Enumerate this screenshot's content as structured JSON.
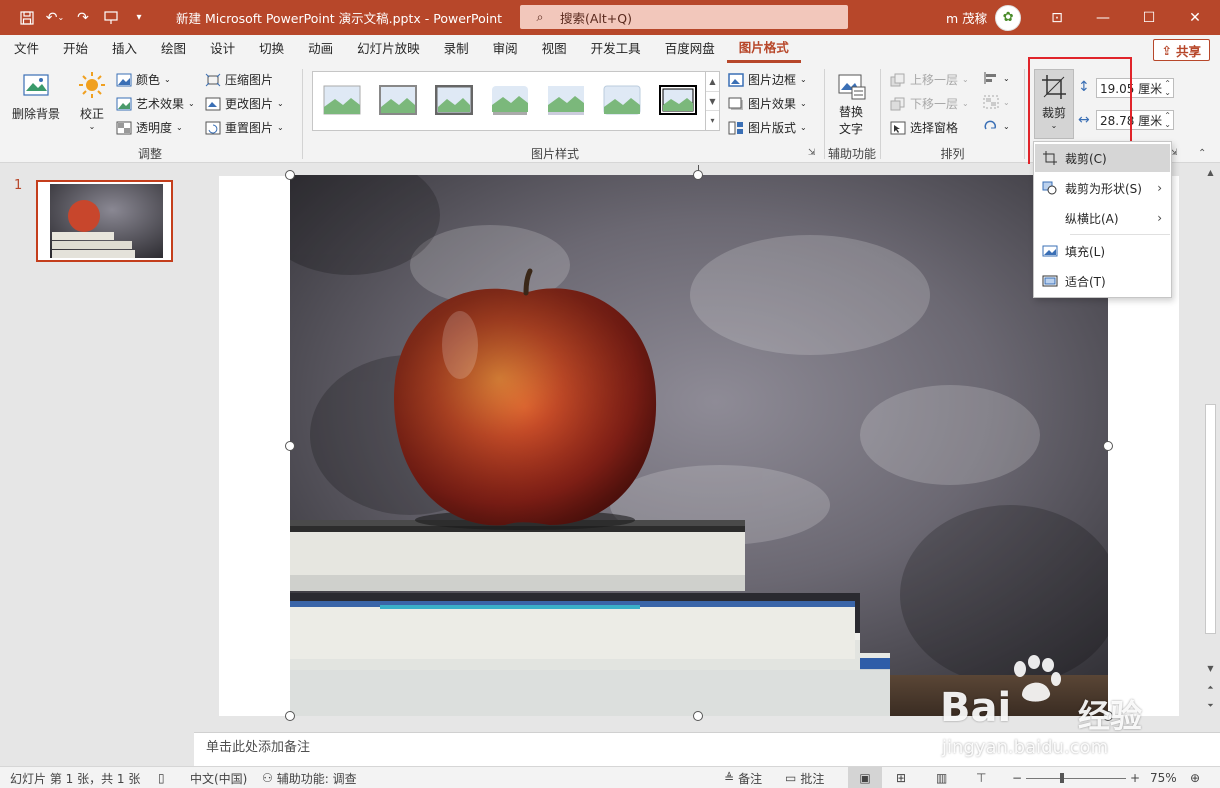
{
  "titlebar": {
    "doc_title": "新建 Microsoft PowerPoint 演示文稿.pptx  -  PowerPoint",
    "search_placeholder": "搜索(Alt+Q)",
    "user_name": "m 茂稼",
    "accent": "#b7472a"
  },
  "tabs": [
    "文件",
    "开始",
    "插入",
    "绘图",
    "设计",
    "切换",
    "动画",
    "幻灯片放映",
    "录制",
    "审阅",
    "视图",
    "开发工具",
    "百度网盘",
    "图片格式"
  ],
  "active_tab": "图片格式",
  "share_label": "共享",
  "ribbon": {
    "remove_bg": "删除背景",
    "correct": "校正",
    "color": "颜色",
    "artistic": "艺术效果",
    "transparency": "透明度",
    "compress": "压缩图片",
    "change_pic": "更改图片",
    "reset_pic": "重置图片",
    "group_adjust": "调整",
    "group_styles": "图片样式",
    "pic_border": "图片边框",
    "pic_effects": "图片效果",
    "pic_layout": "图片版式",
    "alt_text_line1": "替换",
    "alt_text_line2": "文字",
    "group_accessibility": "辅助功能",
    "bring_forward": "上移一层",
    "send_backward": "下移一层",
    "selection_pane": "选择窗格",
    "group_arrange": "排列",
    "crop": "裁剪",
    "height_value": "19.05 厘米",
    "width_value": "28.78 厘米"
  },
  "crop_menu": {
    "items": [
      {
        "label": "裁剪(C)"
      },
      {
        "label": "裁剪为形状(S)"
      },
      {
        "label": "纵横比(A)"
      },
      {
        "label": "填充(L)"
      },
      {
        "label": "适合(T)"
      }
    ]
  },
  "slides_pane": {
    "slide_number": "1"
  },
  "notes_placeholder": "单击此处添加备注",
  "status": {
    "slide_info": "幻灯片 第 1 张，共 1 张",
    "language": "中文(中国)",
    "accessibility": "辅助功能: 调查",
    "notes": "备注",
    "comments": "批注",
    "zoom": "75%"
  },
  "watermark": {
    "brand": "Bai",
    "brand_cn": "经验",
    "url": "jingyan.baidu.com"
  }
}
